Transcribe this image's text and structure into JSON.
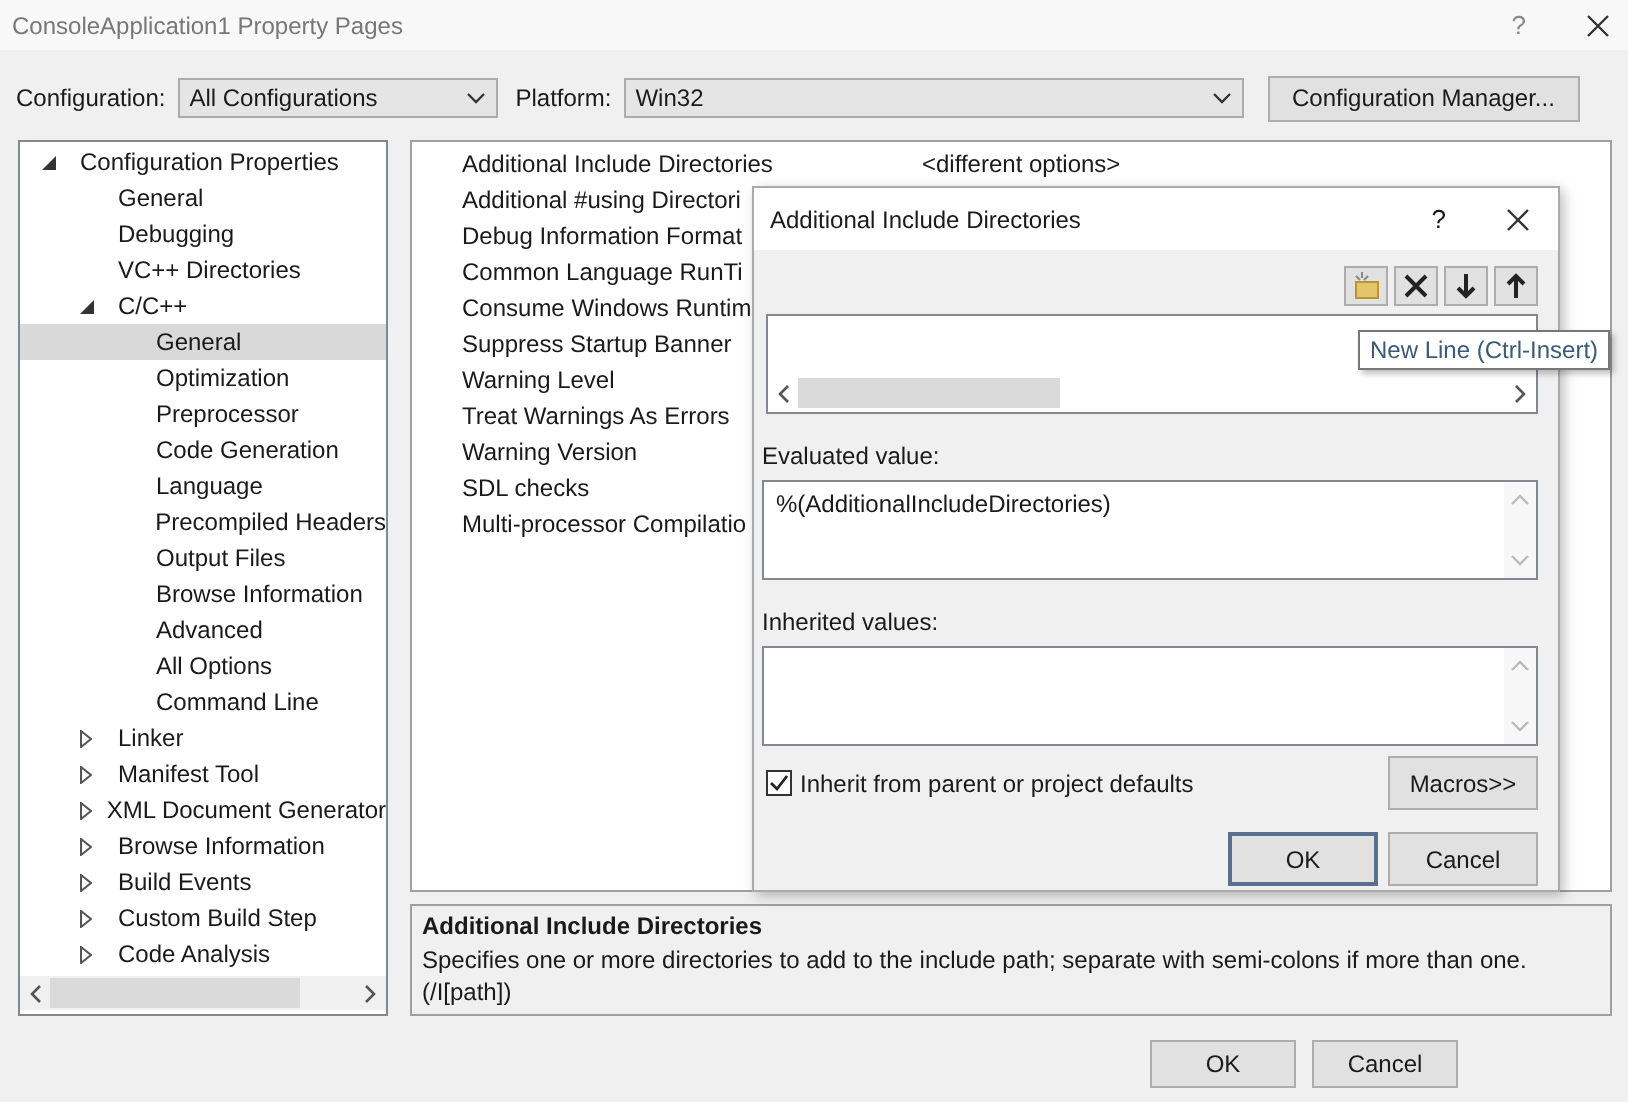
{
  "window": {
    "title": "ConsoleApplication1 Property Pages",
    "help": "?"
  },
  "toolbar": {
    "configuration_label": "Configuration:",
    "configuration": "All Configurations",
    "platform_label": "Platform:",
    "platform": "Win32",
    "manager_button": "Configuration Manager..."
  },
  "tree": [
    {
      "label": "Configuration Properties",
      "expanded": true,
      "selected": false,
      "children": [
        {
          "label": "General",
          "selected": false
        },
        {
          "label": "Debugging",
          "selected": false
        },
        {
          "label": "VC++ Directories",
          "selected": false
        },
        {
          "label": "C/C++",
          "expanded": true,
          "selected": false,
          "children": [
            {
              "label": "General",
              "selected": true
            },
            {
              "label": "Optimization",
              "selected": false
            },
            {
              "label": "Preprocessor",
              "selected": false
            },
            {
              "label": "Code Generation",
              "selected": false
            },
            {
              "label": "Language",
              "selected": false
            },
            {
              "label": "Precompiled Headers",
              "selected": false
            },
            {
              "label": "Output Files",
              "selected": false
            },
            {
              "label": "Browse Information",
              "selected": false
            },
            {
              "label": "Advanced",
              "selected": false
            },
            {
              "label": "All Options",
              "selected": false
            },
            {
              "label": "Command Line",
              "selected": false
            }
          ]
        },
        {
          "label": "Linker",
          "expanded": false,
          "selected": false
        },
        {
          "label": "Manifest Tool",
          "expanded": false,
          "selected": false
        },
        {
          "label": "XML Document Generator",
          "expanded": false,
          "selected": false
        },
        {
          "label": "Browse Information",
          "expanded": false,
          "selected": false
        },
        {
          "label": "Build Events",
          "expanded": false,
          "selected": false
        },
        {
          "label": "Custom Build Step",
          "expanded": false,
          "selected": false
        },
        {
          "label": "Code Analysis",
          "expanded": false,
          "selected": false
        }
      ]
    }
  ],
  "properties": [
    {
      "name": "Additional Include Directories",
      "value": "<different options>"
    },
    {
      "name": "Additional #using Directori"
    },
    {
      "name": "Debug Information Format"
    },
    {
      "name": "Common Language RunTi"
    },
    {
      "name": "Consume Windows Runtim"
    },
    {
      "name": "Suppress Startup Banner"
    },
    {
      "name": "Warning Level"
    },
    {
      "name": "Treat Warnings As Errors"
    },
    {
      "name": "Warning Version"
    },
    {
      "name": "SDL checks"
    },
    {
      "name": "Multi-processor Compilatio"
    }
  ],
  "description": {
    "title": "Additional Include Directories",
    "text": "Specifies one or more directories to add to the include path; separate with semi-colons if more than one.",
    "option_syntax": "(/I[path])"
  },
  "buttons": [
    {
      "label": "OK"
    },
    {
      "label": "Cancel"
    }
  ],
  "dialog": {
    "title": "Additional Include Directories",
    "help": "?",
    "tooltip": "New Line (Ctrl-Insert)",
    "evaluated_label": "Evaluated value:",
    "evaluated_value": "%(AdditionalIncludeDirectories)",
    "inherited_label": "Inherited values:",
    "inherit": {
      "label": "Inherit from parent or project defaults",
      "checked": true
    },
    "macros_button": "Macros>>",
    "buttons": [
      {
        "label": "OK",
        "default": true
      },
      {
        "label": "Cancel",
        "default": false
      }
    ]
  }
}
